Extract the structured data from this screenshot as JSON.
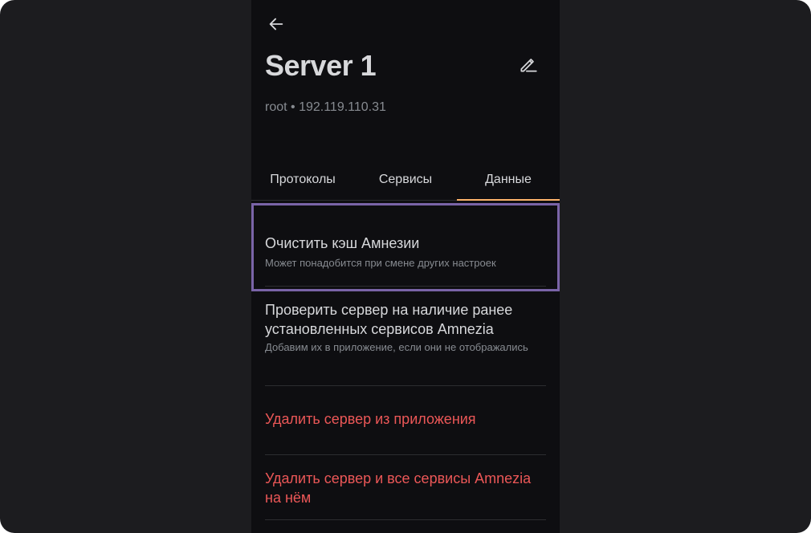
{
  "header": {
    "back_icon": "arrow-left-icon",
    "title": "Server 1",
    "edit_icon": "pencil-icon",
    "subtitle": "root • 192.119.110.31"
  },
  "tabs": [
    {
      "label": "Протоколы",
      "active": false
    },
    {
      "label": "Сервисы",
      "active": false
    },
    {
      "label": "Данные",
      "active": true
    }
  ],
  "items": [
    {
      "title": "Очистить кэш Амнезии",
      "description": "Может понадобится при смене других настроек"
    },
    {
      "title": "Проверить сервер на наличие ранее установленных сервисов Amnezia",
      "description": "Добавим их в приложение, если они не отображались"
    },
    {
      "title": "Удалить сервер из приложения"
    },
    {
      "title": "Удалить сервер и все сервисы Amnezia на нём"
    }
  ],
  "colors": {
    "background": "#0e0e11",
    "outer_background": "#1c1c1f",
    "text_primary": "#d7d8db",
    "text_secondary": "#878b91",
    "accent": "#fbb26a",
    "danger": "#eb5757",
    "highlight": "#7a64a8"
  }
}
